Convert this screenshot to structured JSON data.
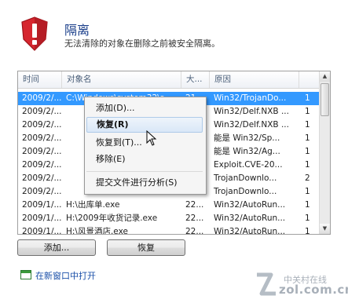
{
  "header": {
    "title": "隔离",
    "subtitle": "无法清除的对象在删除之前被安全隔离。"
  },
  "columns": [
    "时间",
    "对象名",
    "大...",
    "原因",
    ""
  ],
  "rows": [
    {
      "time": "2009/2/...",
      "name": "C:\\Windows\\system32\\s...",
      "size": "21...",
      "reason": "Win32/TrojanDo...",
      "count": "1"
    },
    {
      "time": "2009/2/...",
      "name": "",
      "size": "",
      "reason": "Win32/Delf.NXB ...",
      "count": "1"
    },
    {
      "time": "2009/2/...",
      "name": "",
      "size": "",
      "reason": "Win32/Delf.NXB ...",
      "count": "1"
    },
    {
      "time": "2009/2/...",
      "name": "",
      "size": "",
      "reason": "能是 Win32/Sp...",
      "count": "1"
    },
    {
      "time": "2009/2/...",
      "name": "",
      "size": "",
      "reason": "能是 Win32/Ag...",
      "count": "1"
    },
    {
      "time": "2009/2/...",
      "name": "",
      "size": "",
      "reason": "Exploit.CVE-20...",
      "count": "1"
    },
    {
      "time": "2009/2/...",
      "name": "",
      "size": "",
      "reason": "TrojanDownlo...",
      "count": "2"
    },
    {
      "time": "2009/2/...",
      "name": "",
      "size": "",
      "reason": "TrojanDownlo...",
      "count": "1"
    },
    {
      "time": "2009/1/...",
      "name": "H:\\出库单.exe",
      "size": "22...",
      "reason": "Win32/AutoRun...",
      "count": "1"
    },
    {
      "time": "2009/1/...",
      "name": "H:\\2009年收货记录.exe",
      "size": "22...",
      "reason": "Win32/AutoRun...",
      "count": "1"
    },
    {
      "time": "2009/1/...",
      "name": "H:\\风景酒店.exe",
      "size": "22...",
      "reason": "Win32/AutoRun...",
      "count": "1"
    }
  ],
  "context_menu": {
    "add": "添加(D)...",
    "restore": "恢复(R)",
    "restore_to": "恢复到(T)...",
    "remove": "移除(E)",
    "submit": "提交文件进行分析(S)"
  },
  "buttons": {
    "add": "添加...",
    "restore": "恢复"
  },
  "open_link": "在新窗口中打开",
  "watermark": {
    "zh": "中关村在线",
    "en": "zol.com.cn"
  },
  "colors": {
    "selection": "#3399ff",
    "shield_red": "#d6262f",
    "title_blue": "#1a3e8a",
    "link_blue": "#1a4fa8"
  },
  "icons": [
    "shield-icon",
    "cursor-icon",
    "new-window-icon",
    "scroll-up-icon",
    "scroll-down-icon"
  ]
}
